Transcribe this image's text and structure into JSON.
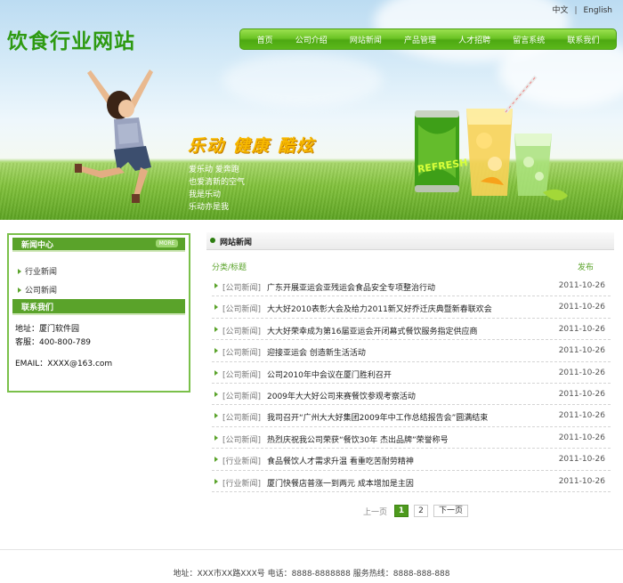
{
  "site": {
    "logo": "饮食行业网站"
  },
  "lang": {
    "zh": "中文",
    "sep": "|",
    "en": "English"
  },
  "nav": [
    "首页",
    "公司介绍",
    "网站新闻",
    "产品管理",
    "人才招聘",
    "留言系统",
    "联系我们"
  ],
  "banner": {
    "slogan": "乐动 健康 酷炫",
    "poem": [
      "爱乐动  爱奔跑",
      "也爱清新的空气",
      "我是乐动",
      "乐动亦是我"
    ],
    "can_label": "REFRESH"
  },
  "sidebar": {
    "news_title": "新闻中心",
    "more_label": "MORE",
    "items": [
      "行业新闻",
      "公司新闻"
    ],
    "contact_title": "联系我们",
    "address": "地址：厦门软件园",
    "phone": "客服：400-800-789",
    "email": "EMAIL：XXXX@163.com"
  },
  "main": {
    "title": "网站新闻",
    "col_title": "分类/标题",
    "col_date": "发布",
    "rows": [
      {
        "cat": "[公司新闻]",
        "title": "广东开展亚运会亚残运会食品安全专项整治行动",
        "date": "2011-10-26"
      },
      {
        "cat": "[公司新闻]",
        "title": "大大好2010表彰大会及给力2011新又好乔迁庆典暨新春联欢会",
        "date": "2011-10-26"
      },
      {
        "cat": "[公司新闻]",
        "title": "大大好荣幸成为第16届亚运会开闭幕式餐饮服务指定供应商",
        "date": "2011-10-26"
      },
      {
        "cat": "[公司新闻]",
        "title": "迎接亚运会 创造新生活活动",
        "date": "2011-10-26"
      },
      {
        "cat": "[公司新闻]",
        "title": "公司2010年中会议在厦门胜利召开",
        "date": "2011-10-26"
      },
      {
        "cat": "[公司新闻]",
        "title": "2009年大大好公司来赛餐饮参观考察活动",
        "date": "2011-10-26"
      },
      {
        "cat": "[公司新闻]",
        "title": "我司召开“广州大大好集团2009年中工作总结报告会”圆满结束",
        "date": "2011-10-26"
      },
      {
        "cat": "[公司新闻]",
        "title": "热烈庆祝我公司荣获“餐饮30年 杰出品牌”荣誉称号",
        "date": "2011-10-26"
      },
      {
        "cat": "[行业新闻]",
        "title": "食品餐饮人才需求升温 看重吃苦耐劳精神",
        "date": "2011-10-26"
      },
      {
        "cat": "[行业新闻]",
        "title": "厦门快餐店普涨一到两元 成本增加是主因",
        "date": "2011-10-26"
      }
    ],
    "pager": {
      "prev": "上一页",
      "pages": [
        "1",
        "2"
      ],
      "next": "下一页"
    }
  },
  "footer": {
    "text": "地址：XXX市XX路XXX号 电话：8888-8888888 服务热线：8888-888-888"
  },
  "colors": {
    "brand_green": "#2e9a12",
    "nav_green": "#5bb81a",
    "accent_yellow": "#f7b800"
  }
}
